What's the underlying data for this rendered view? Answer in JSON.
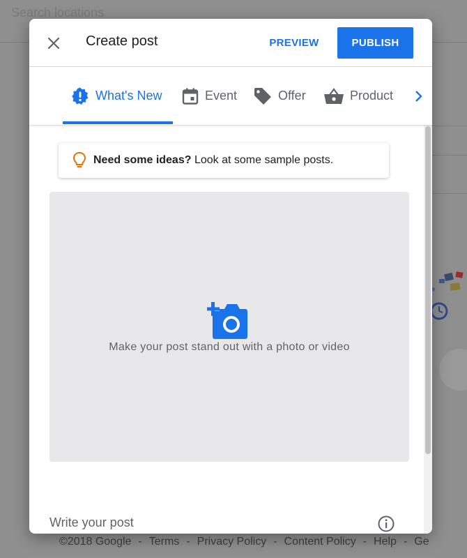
{
  "background": {
    "search_placeholder": "Search locations",
    "footer": {
      "copyright": "©2018 Google",
      "separator": "-",
      "links": [
        "Terms",
        "Privacy Policy",
        "Content Policy",
        "Help",
        "Ge"
      ]
    }
  },
  "dialog": {
    "close_icon": "close-icon",
    "title": "Create post",
    "preview_label": "PREVIEW",
    "publish_label": "PUBLISH",
    "tabs": [
      {
        "label": "What's New",
        "icon": "whats-new-icon",
        "active": true
      },
      {
        "label": "Event",
        "icon": "calendar-icon",
        "active": false
      },
      {
        "label": "Offer",
        "icon": "tag-icon",
        "active": false
      },
      {
        "label": "Product",
        "icon": "basket-icon",
        "active": false
      }
    ],
    "next_tab_icon": "chevron-right-icon",
    "ideas": {
      "bold": "Need some ideas?",
      "text": " Look at some sample posts."
    },
    "media": {
      "text": "Make your post stand out with a photo or video",
      "icon": "add-photo-icon"
    },
    "post": {
      "placeholder": "Write your post",
      "info_icon": "info-icon"
    }
  },
  "colors": {
    "accent": "#1a73e8",
    "idea_bulb": "#e37400",
    "media_bg": "#e8e8eb",
    "overlay": "#8f8f8f"
  }
}
